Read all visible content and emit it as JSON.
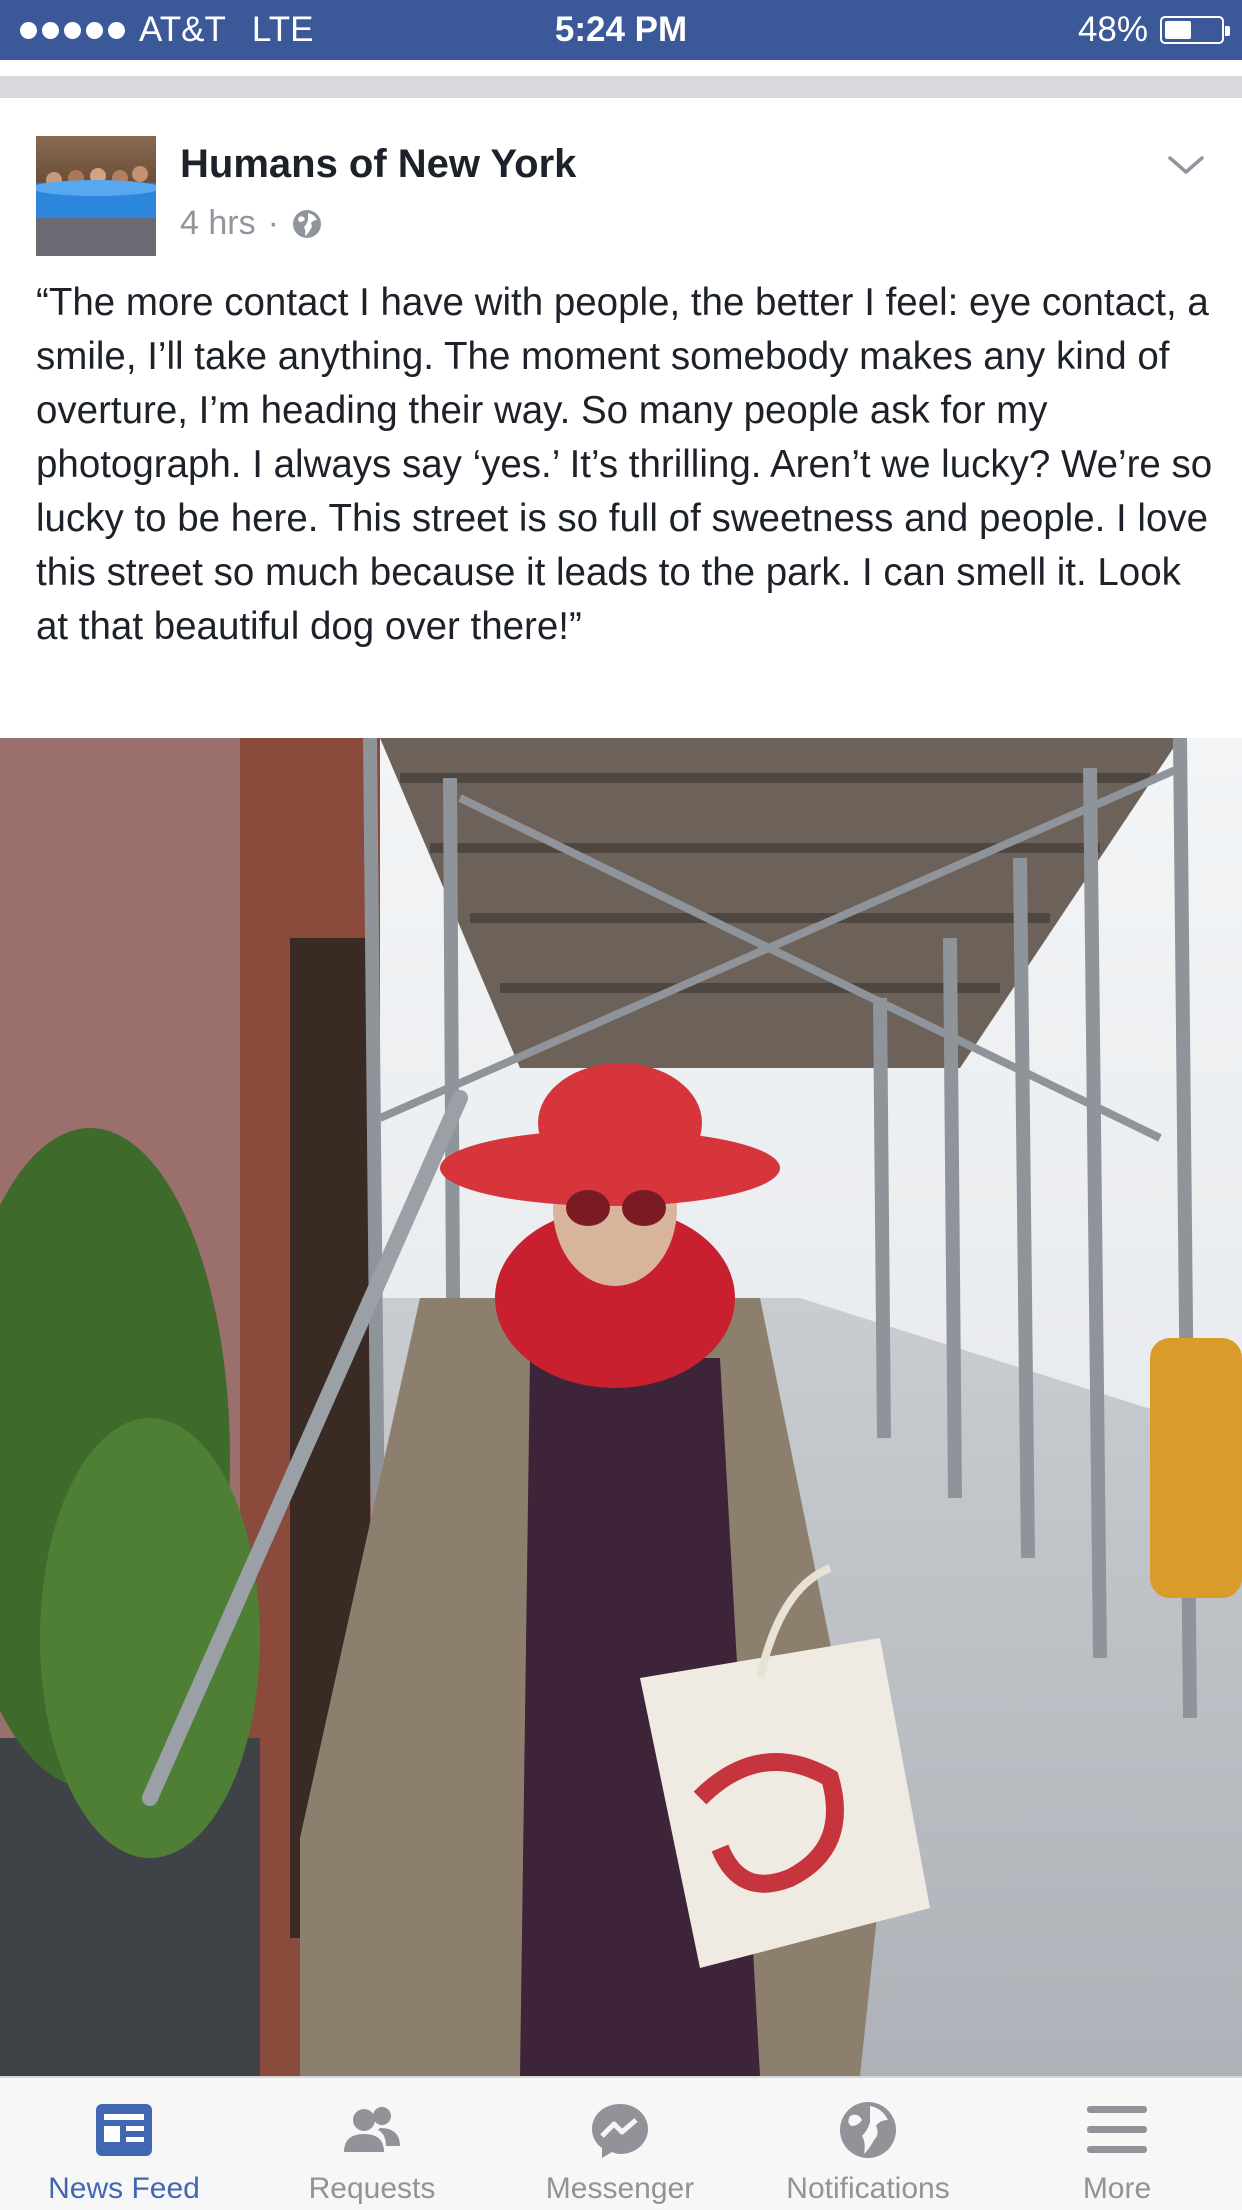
{
  "status_bar": {
    "carrier": "AT&T",
    "network": "LTE",
    "time": "5:24 PM",
    "battery_percent": "48%",
    "battery_level": 0.48
  },
  "post": {
    "page_name": "Humans of New York",
    "timestamp": "4 hrs",
    "separator": "·",
    "text": "“The more contact I have with people, the better I feel: eye contact, a smile, I’ll take anything.  The moment somebody makes any kind of overture, I’m heading their way.  So many people ask for my photograph.  I always say ‘yes.’  It’s thrilling.  Aren’t we lucky?  We’re so lucky to be here.  This street is so full of sweetness and people.  I love this street so much because it leads to the park.  I can smell it.  Look at that beautiful dog over there!”"
  },
  "tab_bar": {
    "tabs": [
      {
        "label": "News Feed",
        "icon": "news-feed-icon",
        "active": true
      },
      {
        "label": "Requests",
        "icon": "friend-requests-icon",
        "active": false
      },
      {
        "label": "Messenger",
        "icon": "messenger-icon",
        "active": false
      },
      {
        "label": "Notifications",
        "icon": "globe-icon",
        "active": false
      },
      {
        "label": "More",
        "icon": "menu-icon",
        "active": false
      }
    ]
  },
  "colors": {
    "brand_blue": "#3b5998",
    "active_tab": "#4267b2",
    "inactive_tab": "#929399"
  }
}
